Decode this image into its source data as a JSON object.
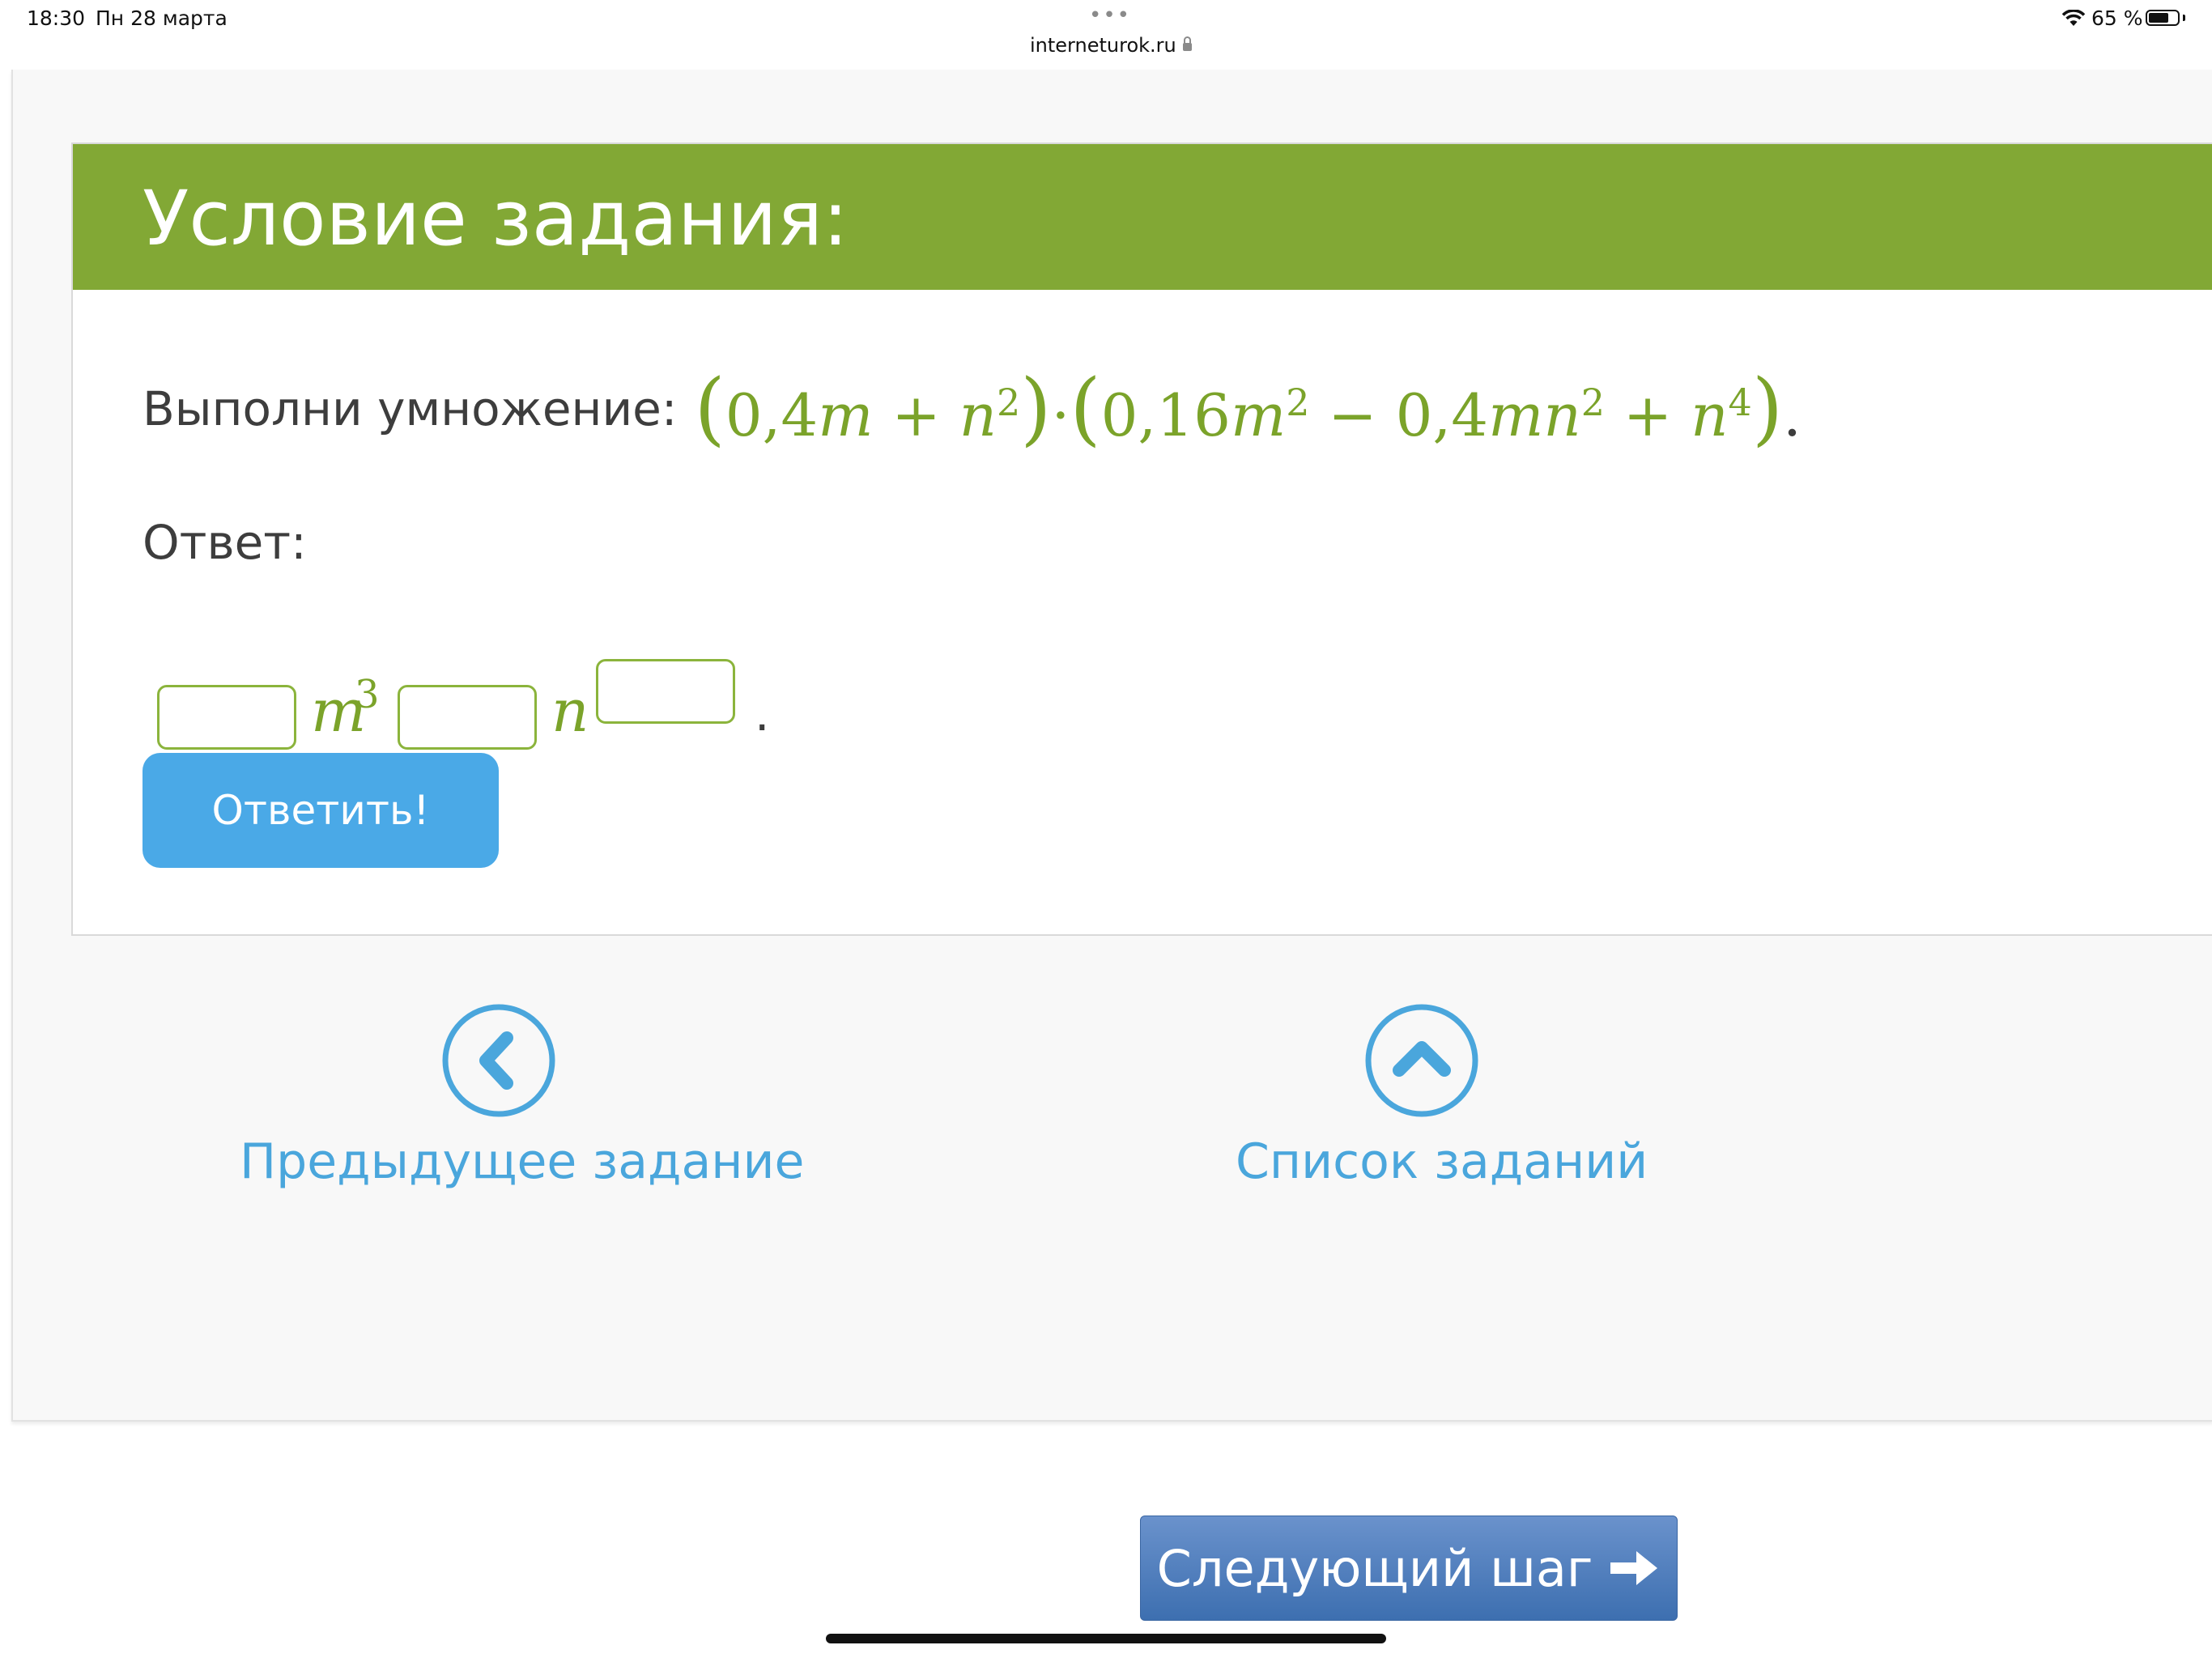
{
  "status_bar": {
    "time": "18:30",
    "date": "Пн 28 марта",
    "url": "interneturok.ru",
    "battery": "65 %"
  },
  "task": {
    "header_title": "Условие задания:",
    "problem_label": "Выполни умножение:",
    "formula": {
      "p1": "0,4",
      "v1": "m",
      "plus1": " + ",
      "v2": "n",
      "e2": "2",
      "dot": "·",
      "p2": "0,16",
      "v3": "m",
      "e3": "2",
      "minus": " − 0,4",
      "v4": "mn",
      "e4": "2",
      "plus2": " + ",
      "v5": "n",
      "e5": "4"
    },
    "answer_label": "Ответ:",
    "answer": {
      "var_m": "m",
      "exp_m": "3",
      "var_n": "n",
      "input1_value": "",
      "input2_value": "",
      "input3_value": "",
      "end": "."
    },
    "submit_label": "Ответить!"
  },
  "navigation": {
    "prev_label": "Предыдущее задание",
    "list_label": "Список заданий",
    "next_step_label": "Следующий шаг"
  },
  "colors": {
    "header_green": "#82a835",
    "formula_green": "#7ba32a",
    "button_blue": "#4aa9e7",
    "nav_blue": "#4aa6dc",
    "next_step_blue": "#3d6fb0"
  },
  "icons": {
    "prev": "chevron-left-circle-icon",
    "list": "chevron-up-circle-icon",
    "next": "arrow-right-icon"
  }
}
